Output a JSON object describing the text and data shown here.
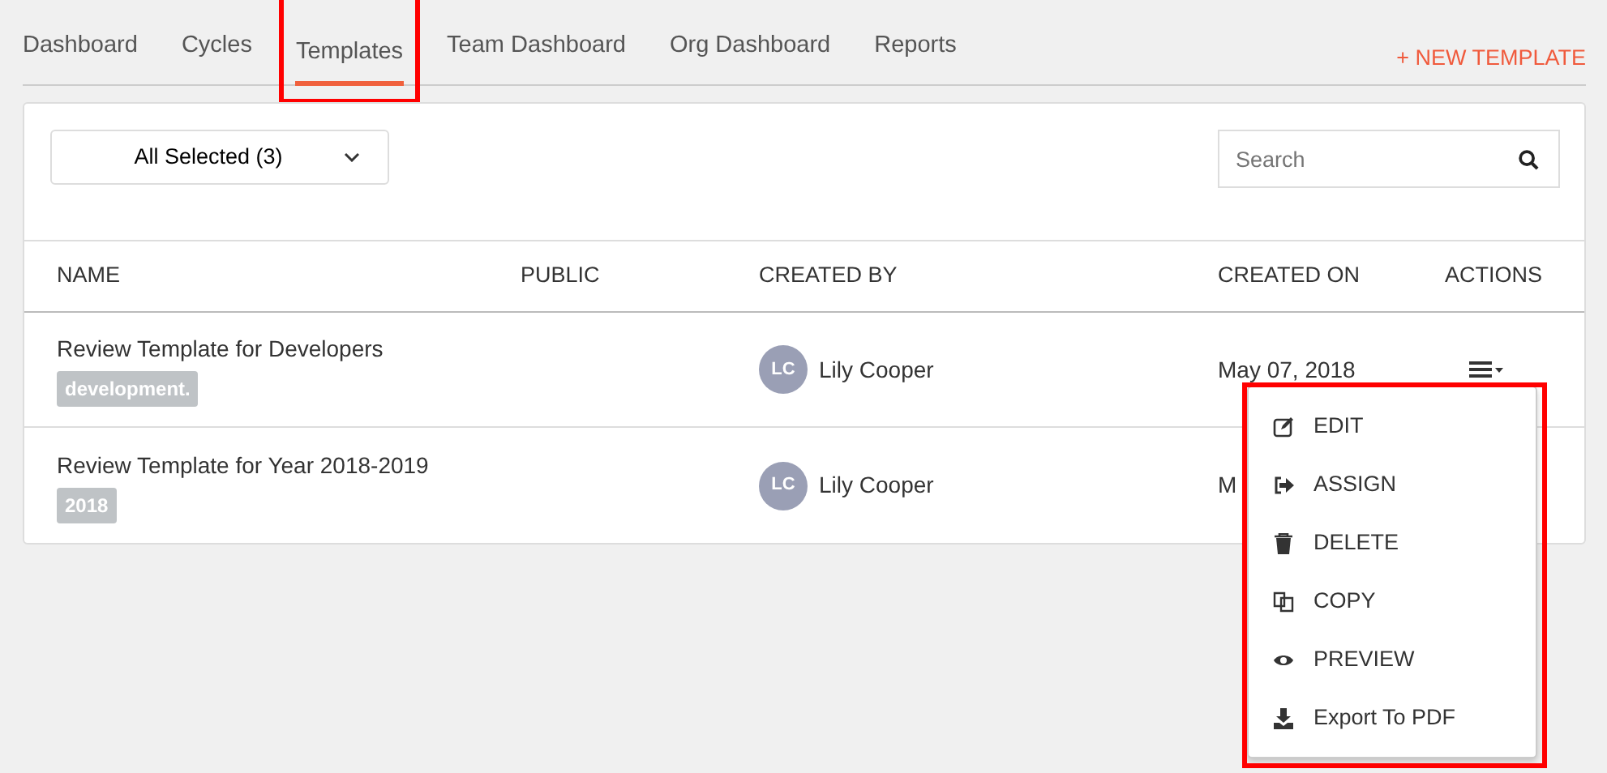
{
  "tabs": [
    {
      "label": "Dashboard",
      "selected": false,
      "highlighted": false
    },
    {
      "label": "Cycles",
      "selected": false,
      "highlighted": false
    },
    {
      "label": "Templates",
      "selected": true,
      "highlighted": true
    },
    {
      "label": "Team Dashboard",
      "selected": false,
      "highlighted": false
    },
    {
      "label": "Org Dashboard",
      "selected": false,
      "highlighted": false
    },
    {
      "label": "Reports",
      "selected": false,
      "highlighted": false
    }
  ],
  "new_template_link": "+ NEW TEMPLATE",
  "filter": {
    "value": "All Selected (3)"
  },
  "search": {
    "placeholder": "Search"
  },
  "table": {
    "columns": [
      "NAME",
      "PUBLIC",
      "CREATED BY",
      "CREATED ON",
      "ACTIONS"
    ],
    "rows": [
      {
        "name": "Review Template for Developers",
        "tag": "development.",
        "avatar": "LC",
        "created_by": "Lily Cooper",
        "created_on": "May 07, 2018",
        "has_actions": true
      },
      {
        "name": "Review Template for Year 2018-2019",
        "tag": "2018",
        "avatar": "LC",
        "created_by": "Lily Cooper",
        "created_on": "M",
        "has_actions": false
      }
    ]
  },
  "actions_menu": {
    "highlighted": true,
    "items": [
      {
        "kind": "edit",
        "label": "EDIT"
      },
      {
        "kind": "assign",
        "label": "ASSIGN"
      },
      {
        "kind": "delete",
        "label": "DELETE"
      },
      {
        "kind": "copy",
        "label": "COPY"
      },
      {
        "kind": "preview",
        "label": "PREVIEW"
      },
      {
        "kind": "export",
        "label": "Export To PDF"
      }
    ]
  }
}
